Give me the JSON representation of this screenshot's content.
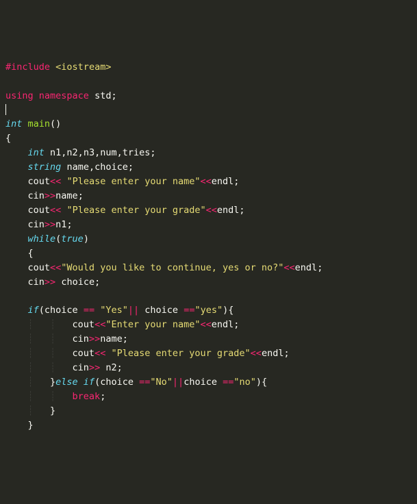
{
  "code": {
    "include_kw": "#include",
    "include_lib": "<iostream>",
    "using": "using",
    "namespace": "namespace",
    "std": "std",
    "int": "int",
    "string_t": "string",
    "main": "main",
    "decl_vars": "n1,n2,n3,num,tries",
    "decl_strs": "name,choice",
    "cout": "cout",
    "cin": "cin",
    "endl": "endl",
    "while": "while",
    "true": "true",
    "if": "if",
    "else_if": "else if",
    "break": "break",
    "op_ins": "<<",
    "op_ext": ">>",
    "op_eq": "==",
    "op_or": "||",
    "s_name_prompt": "\"Please enter your name\"",
    "s_grade_prompt": "\"Please enter your grade\"",
    "s_continue": "\"Would you like to continue, yes or no?\"",
    "s_Yes": "\"Yes\"",
    "s_yes": "\"yes\"",
    "s_enter_name": "\"Enter your name\"",
    "s_No": "\"No\"",
    "s_no": "\"no\"",
    "v_name": "name",
    "v_choice": "choice",
    "v_n1": "n1",
    "v_n2": "n2"
  }
}
